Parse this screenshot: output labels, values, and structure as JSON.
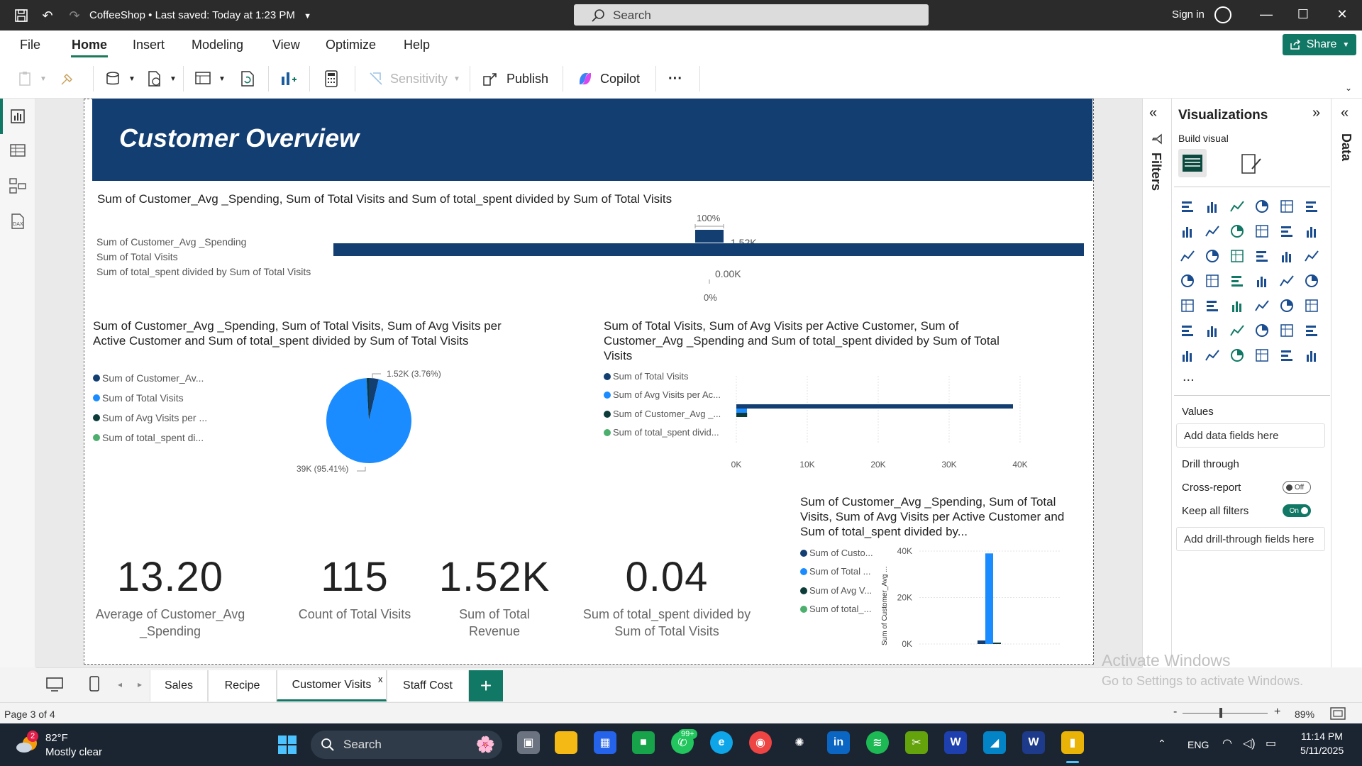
{
  "titlebar": {
    "doc_title": "CoffeeShop",
    "save_status": "Last saved: Today at 1:23 PM",
    "search_placeholder": "Search",
    "signin_label": "Sign in"
  },
  "menu": {
    "items": [
      "File",
      "Home",
      "Insert",
      "Modeling",
      "View",
      "Optimize",
      "Help"
    ],
    "active": "Home",
    "share_label": "Share"
  },
  "ribbon": {
    "sensitivity_label": "Sensitivity",
    "publish_label": "Publish",
    "copilot_label": "Copilot",
    "more_label": "···"
  },
  "report": {
    "banner_title": "Customer Overview",
    "visual1": {
      "title": "Sum of Customer_Avg _Spending, Sum of Total Visits and Sum of total_spent divided by Sum of Total Visits",
      "rows": [
        "Sum of Customer_Avg _Spending",
        "Sum of Total Visits",
        "Sum of total_spent divided by Sum of Total Visits"
      ],
      "pct_top": "100%",
      "pct_bottom": "0%",
      "label_top": "1.52K",
      "label_bottom": "0.00K"
    },
    "visual2": {
      "title": "Sum of Customer_Avg _Spending, Sum of Total Visits, Sum of Avg Visits per Active Customer and Sum of total_spent divided by Sum of Total Visits",
      "legend": [
        "Sum of Customer_Av...",
        "Sum of Total Visits",
        "Sum of Avg Visits per ...",
        "Sum of total_spent di..."
      ],
      "label_small": "1.52K (3.76%)",
      "label_large": "39K (95.41%)"
    },
    "visual3": {
      "title": "Sum of Total Visits, Sum of Avg Visits per Active Customer, Sum of Customer_Avg _Spending and Sum of total_spent divided by Sum of Total Visits",
      "legend": [
        "Sum of Total Visits",
        "Sum of Avg Visits per Ac...",
        "Sum of Customer_Avg _...",
        "Sum of total_spent divid..."
      ],
      "xticks": [
        "0K",
        "10K",
        "20K",
        "30K",
        "40K"
      ]
    },
    "visual4": {
      "title": "Sum of Customer_Avg _Spending, Sum of Total Visits, Sum of Avg Visits per Active Customer and Sum of total_spent divided by...",
      "legend": [
        "Sum of Custo...",
        "Sum of Total ...",
        "Sum of Avg V...",
        "Sum of total_..."
      ],
      "yaxis_label": "Sum of Customer_Avg ...",
      "yticks": [
        "40K",
        "20K",
        "0K"
      ]
    },
    "cards": [
      {
        "value": "13.20",
        "label_line1": "Average of Customer_Avg",
        "label_line2": "_Spending"
      },
      {
        "value": "115",
        "label_line1": "Count of Total Visits",
        "label_line2": ""
      },
      {
        "value": "1.52K",
        "label_line1": "Sum of Total",
        "label_line2": "Revenue"
      },
      {
        "value": "0.04",
        "label_line1": "Sum of total_spent divided by",
        "label_line2": "Sum of Total Visits"
      }
    ]
  },
  "chart_data": [
    {
      "type": "bar",
      "orientation": "horizontal",
      "title": "Sum of Customer_Avg _Spending, Sum of Total Visits and Sum of total_spent divided by Sum of Total Visits",
      "categories": [
        "Sum of Customer_Avg _Spending",
        "Sum of Total Visits",
        "Sum of total_spent divided by Sum of Total Visits"
      ],
      "values": [
        1520,
        39000,
        0.04
      ]
    },
    {
      "type": "pie",
      "title": "Sum of Customer_Avg _Spending, Sum of Total Visits, Sum of Avg Visits per Active Customer and Sum of total_spent divided by Sum of Total Visits",
      "labels": [
        "Sum of Customer_Av...",
        "Sum of Total Visits",
        "Sum of Avg Visits per ...",
        "Sum of total_spent di..."
      ],
      "values": [
        1520,
        39000,
        350,
        0.04
      ],
      "percent_labels": {
        "Sum of Customer_Av...": "3.76%",
        "Sum of Total Visits": "95.41%"
      }
    },
    {
      "type": "bar",
      "orientation": "horizontal",
      "title": "Sum of Total Visits, Sum of Avg Visits per Active Customer, Sum of Customer_Avg _Spending and Sum of total_spent divided by Sum of Total Visits",
      "series": [
        {
          "name": "Sum of Total Visits",
          "values": [
            39000
          ]
        },
        {
          "name": "Sum of Avg Visits per Ac...",
          "values": [
            350
          ]
        },
        {
          "name": "Sum of Customer_Avg _...",
          "values": [
            1520
          ]
        },
        {
          "name": "Sum of total_spent divid...",
          "values": [
            0.04
          ]
        }
      ],
      "xlim": [
        0,
        40000
      ],
      "xticks": [
        "0K",
        "10K",
        "20K",
        "30K",
        "40K"
      ],
      "grid": true
    },
    {
      "type": "bar",
      "orientation": "vertical",
      "title": "Sum of Customer_Avg _Spending, Sum of Total Visits, Sum of Avg Visits per Active Customer and Sum of total_spent divided by...",
      "ylabel": "Sum of Customer_Avg ...",
      "series": [
        {
          "name": "Sum of Custo...",
          "values": [
            1520
          ]
        },
        {
          "name": "Sum of Total ...",
          "values": [
            39000
          ]
        },
        {
          "name": "Sum of Avg V...",
          "values": [
            350
          ]
        },
        {
          "name": "Sum of total_...",
          "values": [
            0.04
          ]
        }
      ],
      "ylim": [
        0,
        40000
      ],
      "yticks": [
        "0K",
        "20K",
        "40K"
      ],
      "grid": true
    }
  ],
  "colors": {
    "series_dark": "#123e72",
    "series_bright": "#1a8cff",
    "series_deep": "#0c3b3a",
    "series_green": "#4caf6e",
    "accent": "#117865"
  },
  "viz_pane": {
    "title": "Visualizations",
    "build_visual": "Build visual",
    "values_label": "Values",
    "values_placeholder": "Add data fields here",
    "drill_through": "Drill through",
    "cross_report": "Cross-report",
    "cross_report_state": "Off",
    "keep_all_filters": "Keep all filters",
    "keep_filters_state": "On",
    "drill_placeholder": "Add drill-through fields here",
    "more": "...",
    "filters_label": "Filters",
    "data_label": "Data"
  },
  "tabs": [
    "Sales",
    "Recipe",
    "Customer Visits",
    "Staff Cost"
  ],
  "active_tab": "Customer Visits",
  "close_mark": "x",
  "status": {
    "page_info": "Page 3 of 4",
    "zoom": "89%",
    "watermark_line1": "Activate Windows",
    "watermark_line2": "Go to Settings to activate Windows."
  },
  "taskbar": {
    "weather_temp": "82°F",
    "weather_desc": "Mostly clear",
    "weather_badge": "2",
    "search_label": "Search",
    "whatsapp_badge": "99+",
    "lang": "ENG",
    "time": "11:14 PM",
    "date": "5/11/2025"
  }
}
